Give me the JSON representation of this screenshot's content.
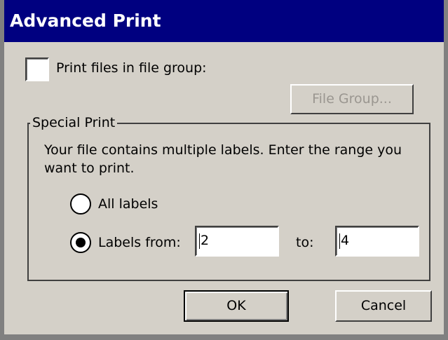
{
  "window": {
    "title": "Advanced Print"
  },
  "file_group": {
    "checkbox_label": "Print files in file group:",
    "checked": false,
    "button_label": "File Group...",
    "button_enabled": false
  },
  "special_print": {
    "legend": "Special Print",
    "description": "Your file contains multiple labels. Enter the range you want to print.",
    "all_labels_label": "All labels",
    "labels_from_label": "Labels from:",
    "selected_option": "labels_from",
    "from_value": "2",
    "to_label": "to:",
    "to_value": "4"
  },
  "buttons": {
    "ok_label": "OK",
    "cancel_label": "Cancel"
  },
  "colors": {
    "title_bar": "#000080",
    "dialog_face": "#d4d0c8",
    "disabled_text": "#9a9690"
  }
}
